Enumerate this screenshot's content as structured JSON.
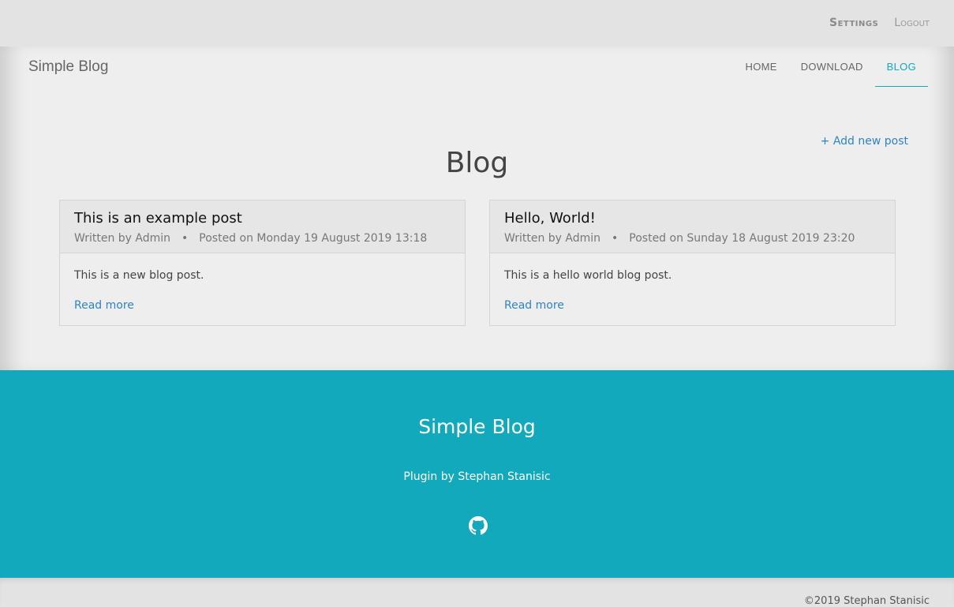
{
  "topbar": {
    "settings": "Settings",
    "logout": "Logout"
  },
  "header": {
    "brand": "Simple Blog",
    "nav": [
      {
        "label": "HOME",
        "active": false
      },
      {
        "label": "DOWNLOAD",
        "active": false
      },
      {
        "label": "BLOG",
        "active": true
      }
    ]
  },
  "main": {
    "add_post": "+ Add new post",
    "title": "Blog",
    "posts": [
      {
        "title": "This is an example post",
        "author": "Written by Admin",
        "posted": "Posted on Monday 19 August 2019 13:18",
        "excerpt": "This is a new blog post.",
        "read_more": "Read more"
      },
      {
        "title": "Hello, World!",
        "author": "Written by Admin",
        "posted": "Posted on Sunday 18 August 2019 23:20",
        "excerpt": "This is a hello world blog post.",
        "read_more": "Read more"
      }
    ]
  },
  "footer": {
    "title": "Simple Blog",
    "subtitle": "Plugin by Stephan Stanisic",
    "icon": "github-icon",
    "copyright": "©2019 Stephan Stanisic"
  },
  "colors": {
    "accent": "#11a9bb",
    "link": "#2e83c8"
  }
}
